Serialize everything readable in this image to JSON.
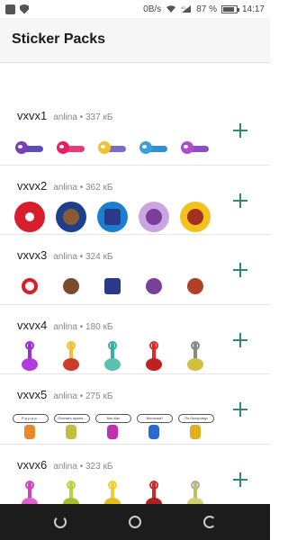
{
  "status_bar": {
    "network": "0B/s",
    "signal_label": "4G",
    "battery_text": "87 %",
    "battery_level": 0.87,
    "time": "14:17",
    "icons": [
      "notification-icon",
      "shield-icon",
      "wifi-icon",
      "signal-icon",
      "battery-icon"
    ]
  },
  "header": {
    "title": "Sticker Packs"
  },
  "packs": [
    {
      "name": "vxvx1",
      "author": "anlina",
      "size": "337 кБ",
      "add_icon": "plus-icon"
    },
    {
      "name": "vxvx2",
      "author": "anlina",
      "size": "362 кБ",
      "add_icon": "plus-icon"
    },
    {
      "name": "vxvx3",
      "author": "anlina",
      "size": "324 кБ",
      "add_icon": "plus-icon"
    },
    {
      "name": "vxvx4",
      "author": "anlina",
      "size": "180 кБ",
      "add_icon": "plus-icon"
    },
    {
      "name": "vxvx5",
      "author": "anlina",
      "size": "275 кБ",
      "add_icon": "plus-icon",
      "sticker_texts": [
        "Р-р-р-р-р...",
        "Поспать нужно...",
        "Кис-Кис",
        "Молочка?",
        "По быстрому!"
      ]
    },
    {
      "name": "vxvx6",
      "author": "anlina",
      "size": "323 кБ",
      "add_icon": "plus-icon"
    }
  ],
  "colors": {
    "accent": "#2f8b6a",
    "nav_bar": "#1c1c1c",
    "header_bg": "#f6f6f6"
  },
  "nav": {
    "icons": [
      "back-icon",
      "home-icon",
      "recent-apps-icon"
    ]
  }
}
